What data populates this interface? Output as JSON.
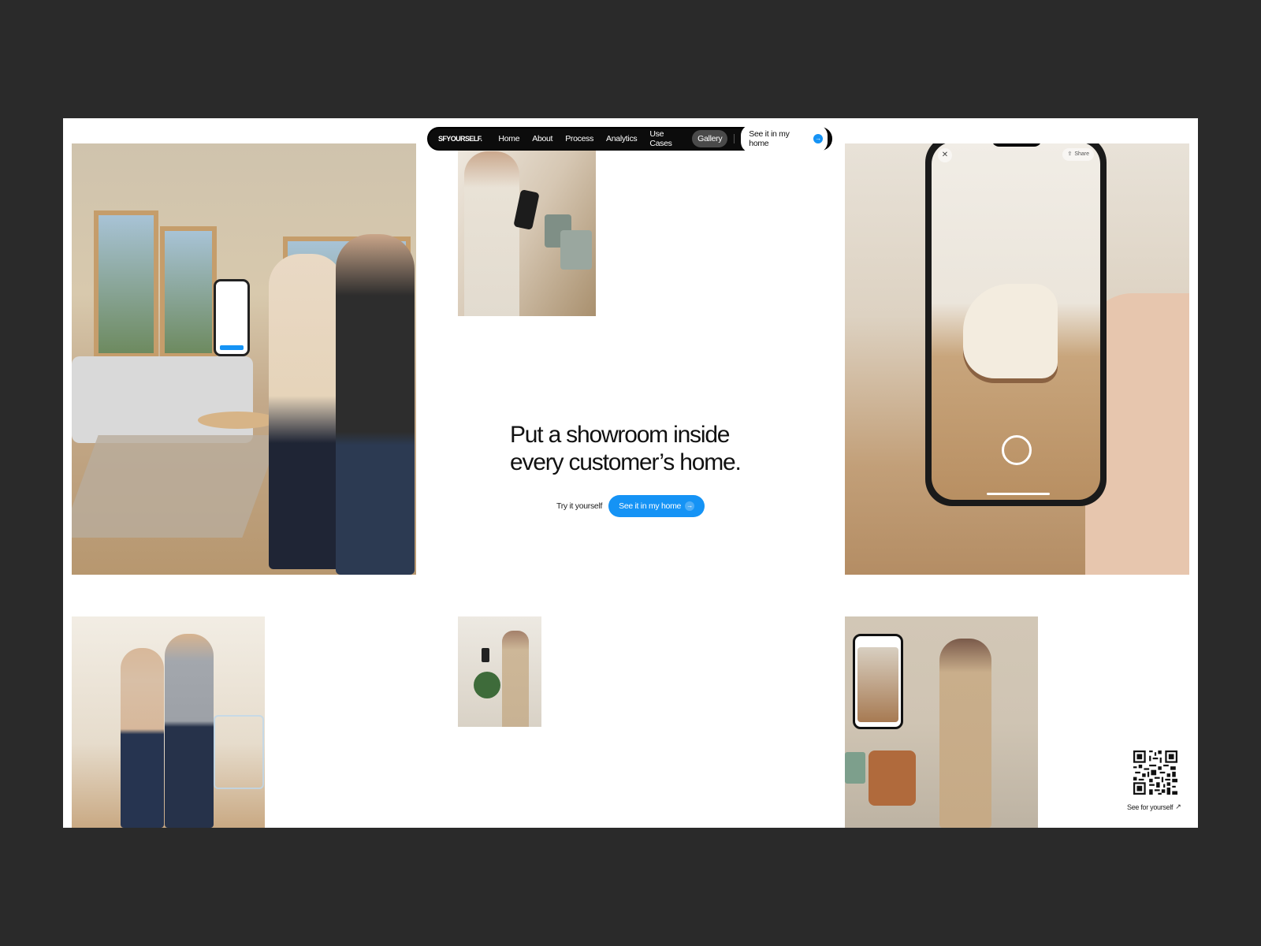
{
  "brand": "SFYOURSELF.",
  "nav": {
    "links": [
      {
        "label": "Home"
      },
      {
        "label": "About"
      },
      {
        "label": "Process"
      },
      {
        "label": "Analytics"
      },
      {
        "label": "Use Cases"
      },
      {
        "label": "Gallery"
      }
    ],
    "active": "Gallery",
    "cta_label": "See it in my home",
    "cta_icon": "arrow-right-icon"
  },
  "hero": {
    "title_line1": "Put a showroom inside",
    "title_line2": "every customer’s home.",
    "secondary_label": "Try it yourself",
    "cta_label": "See it in my home",
    "cta_icon": "arrow-right-icon"
  },
  "phone_ui": {
    "share_label": "Share",
    "close_icon": "close-icon",
    "share_icon": "share-icon"
  },
  "qr": {
    "caption": "See for yourself",
    "icon": "arrow-up-right-icon"
  },
  "colors": {
    "background": "#141414",
    "accent": "#1593f5",
    "nav_bg": "#0c0c0c",
    "page_bg": "#ffffff"
  }
}
